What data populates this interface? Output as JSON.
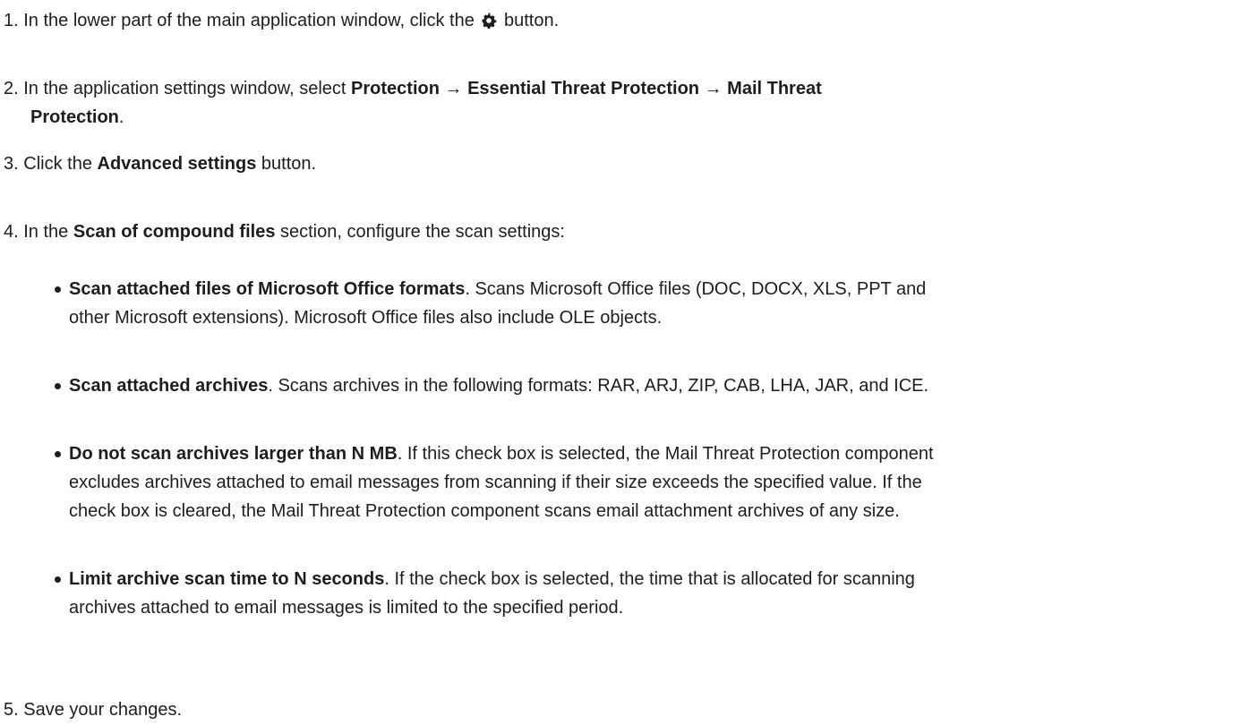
{
  "steps": [
    {
      "number": "1.",
      "before_icon": "In the lower part of the main application window, click the",
      "icon": "gear-icon",
      "after_icon": "button."
    },
    {
      "number": "2.",
      "text_start": "In the application settings window, select",
      "path": [
        "Protection",
        "Essential Threat Protection",
        "Mail Threat Protection"
      ],
      "arrow": "→",
      "path_1": "Protection",
      "path_2": "Essential Threat Protection",
      "path_3a": "Mail Threat",
      "path_3b": "Protection",
      "text_end": "."
    },
    {
      "number": "3.",
      "text_start": "Click the",
      "bold": "Advanced settings",
      "text_end": "button."
    },
    {
      "number": "4.",
      "text_start": "In the",
      "bold": "Scan of compound files",
      "text_end": "section, configure the scan settings:"
    },
    {
      "number": "5.",
      "text": "Save your changes."
    }
  ],
  "settings": [
    {
      "name": "Scan attached files of Microsoft Office formats",
      "line1": ". Scans Microsoft Office files (DOC, DOCX, XLS, PPT and",
      "line2": "other Microsoft extensions). Microsoft Office files also include OLE objects."
    },
    {
      "name": "Scan attached archives",
      "line1": ". Scans archives in the following formats: RAR, ARJ, ZIP, CAB, LHA, JAR, and ICE."
    },
    {
      "name": "Do not scan archives larger than N MB",
      "line1": ". If this check box is selected, the Mail Threat Protection component",
      "line2": "excludes archives attached to email messages from scanning if their size exceeds the specified value. If the",
      "line3": "check box is cleared, the Mail Threat Protection component scans email attachment archives of any size."
    },
    {
      "name": "Limit archive scan time to N seconds",
      "line1": ". If the check box is selected, the time that is allocated for scanning",
      "line2": "archives attached to email messages is limited to the specified period."
    }
  ],
  "colors": {
    "text": "#1d1d1b",
    "background": "#ffffff"
  }
}
